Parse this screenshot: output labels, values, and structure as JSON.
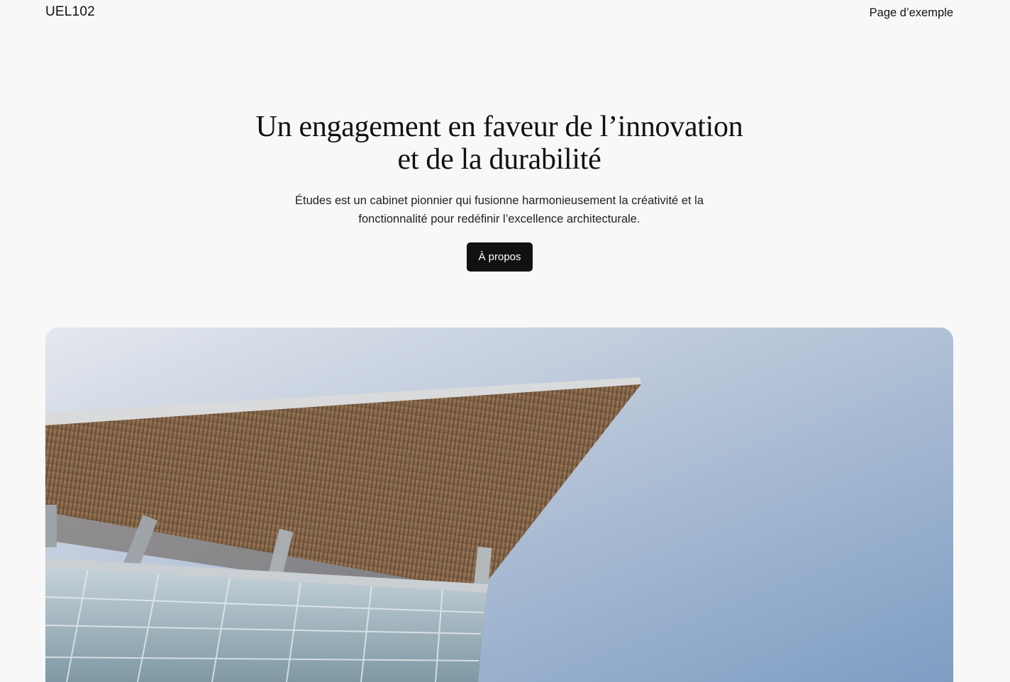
{
  "header": {
    "site_title": "UEL102",
    "nav_link": "Page d’exemple"
  },
  "hero": {
    "title": "Un engagement en faveur de l’innovation et de la durabilité",
    "subtitle": "Études est un cabinet pionnier qui fusionne harmonieusement la créativité et la fonctionnalité pour redéfinir l’excellence architecturale.",
    "cta_label": "À propos"
  },
  "image": {
    "sky_top": "#dfe3ec",
    "sky_bottom": "#7f9fc4",
    "wood": "#a07a52",
    "glass": "#a8bcc6"
  }
}
